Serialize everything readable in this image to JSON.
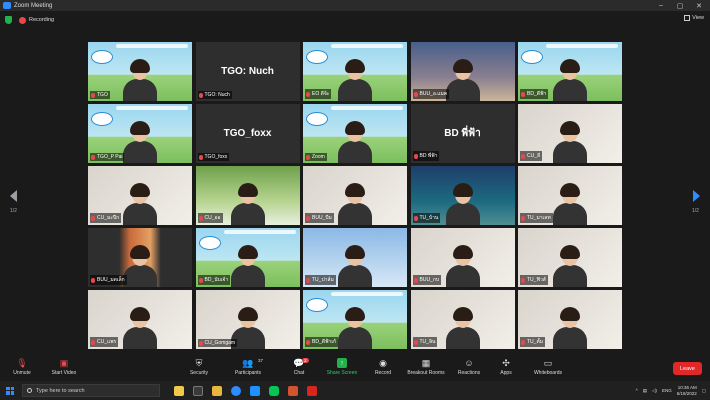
{
  "window": {
    "title": "Zoom Meeting"
  },
  "topbar": {
    "recording_label": "Recording",
    "view_label": "View"
  },
  "colors": {
    "accent": "#2d8cff",
    "leave": "#e02828",
    "recording": "#e5484d",
    "secure": "#23b14d"
  },
  "gallery": {
    "page_left": "1/2",
    "page_right": "1/2",
    "tiles": [
      {
        "name": "TGO",
        "style": "banner people",
        "muted": true
      },
      {
        "name": "TGO: Nuch",
        "style": "text",
        "center": "TGO: Nuch",
        "muted": true
      },
      {
        "name": "EO ดีจ้ะ",
        "style": "banner person",
        "muted": true
      },
      {
        "name": "BUU_อ.แมค",
        "style": "city person",
        "muted": true
      },
      {
        "name": "BD_ดีฟ้า",
        "style": "banner person",
        "muted": true
      },
      {
        "name": "TGO_P Pai",
        "style": "banner person",
        "muted": true
      },
      {
        "name": "TGO_foxx",
        "style": "text",
        "center": "TGO_foxx",
        "muted": true
      },
      {
        "name": "Zoom",
        "style": "banner person",
        "muted": true
      },
      {
        "name": "BD พี่ฟ้า",
        "style": "text",
        "center": "BD พี่ฟ้า",
        "muted": true
      },
      {
        "name": "CU_ลี",
        "style": "photo person",
        "muted": true
      },
      {
        "name": "CU_มะปีก",
        "style": "photo person",
        "muted": true
      },
      {
        "name": "CU_ออ",
        "style": "tree person",
        "muted": true
      },
      {
        "name": "BUU_บีม",
        "style": "photo person",
        "muted": true
      },
      {
        "name": "TU_บ้าน",
        "style": "teal person",
        "muted": true
      },
      {
        "name": "TU_มาเลท",
        "style": "photo person",
        "muted": true
      },
      {
        "name": "BUU_มดเล็ก",
        "style": "red person",
        "muted": true
      },
      {
        "name": "BD_นับเจ้า",
        "style": "banner person",
        "muted": true
      },
      {
        "name": "TU_ปาล์ม",
        "style": "sky person",
        "muted": true
      },
      {
        "name": "BUU_กบ",
        "style": "photo person",
        "muted": true
      },
      {
        "name": "TU_ฟิวส์",
        "style": "photo person",
        "muted": true
      },
      {
        "name": "CU_แพร",
        "style": "photo person",
        "muted": true
      },
      {
        "name": "CU_Gomgam",
        "style": "photo person",
        "muted": true
      },
      {
        "name": "BD_ดีฟ้าเก้",
        "style": "banner person",
        "muted": true
      },
      {
        "name": "TU_ลิน",
        "style": "photo person",
        "muted": true
      },
      {
        "name": "TU_ตั้ม",
        "style": "photo person",
        "muted": true
      }
    ]
  },
  "toolbar": {
    "unmute": "Unmute",
    "start_video": "Start Video",
    "security": "Security",
    "participants": "Participants",
    "participants_count": "37",
    "chat": "Chat",
    "chat_badge": "2",
    "share_screen": "Share Screen",
    "record": "Record",
    "breakout_rooms": "Breakout Rooms",
    "reactions": "Reactions",
    "apps": "Apps",
    "whiteboards": "Whiteboards",
    "leave": "Leave"
  },
  "taskbar": {
    "search_placeholder": "Type here to search",
    "language": "ENG",
    "time": "10:36 AM",
    "date": "6/18/2022"
  }
}
